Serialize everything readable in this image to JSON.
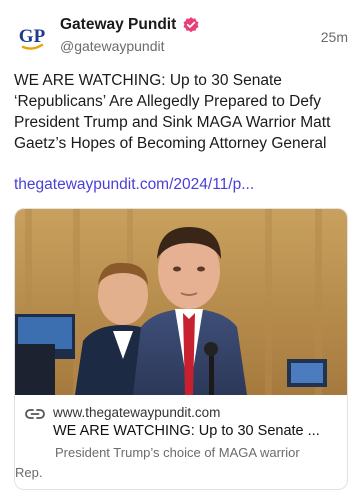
{
  "post": {
    "author": {
      "display_name": "Gateway Pundit",
      "handle": "@gatewaypundit",
      "avatar_text": "GP",
      "verified_icon": "verified-badge-icon",
      "avatar_color": "#1d3c8f",
      "accent_color": "#e8a400"
    },
    "timestamp": "25m",
    "text": "WE ARE WATCHING: Up to 30 Senate ‘Republicans’ Are Allegedly Prepared to Defy President Trump and Sink MAGA Warrior Matt Gaetz’s Hopes of Becoming Attorney General",
    "link_text": "thegatewaypundit.com/2024/11/p...",
    "link_color": "#4a3fd6",
    "card": {
      "icon": "link-icon",
      "domain": "www.thegatewaypundit.com",
      "title": "WE ARE WATCHING: Up to 30 Senate ...",
      "description": "President Trump’s choice of MAGA warrior Rep."
    }
  }
}
